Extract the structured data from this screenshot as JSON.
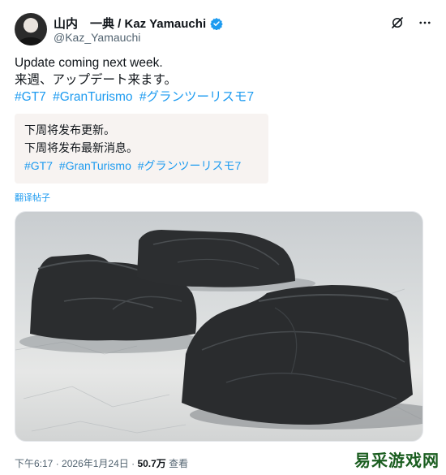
{
  "author": {
    "display_name": "山内　一典 / Kaz Yamauchi",
    "handle": "@Kaz_Yamauchi",
    "verified_icon": "verified-badge-icon",
    "verified_color": "#1d9bf0"
  },
  "header_actions": {
    "grok_icon": "grok-icon",
    "more_icon": "more-dots-icon"
  },
  "tweet": {
    "line1": "Update coming next week.",
    "line2": "来週、アップデート来ます。",
    "hashtags": [
      "#GT7",
      "#GranTurismo",
      "#グランツーリスモ7"
    ]
  },
  "translation": {
    "line1": "下周将发布更新。",
    "line2": "下周将发布最新消息。",
    "hashtags": [
      "#GT7",
      "#GranTurismo",
      "#グランツーリスモ7"
    ],
    "link_label": "翻译帖子"
  },
  "meta": {
    "time": "下午6:17",
    "separator": "·",
    "date": "2026年1月24日",
    "views": "50.7万",
    "views_label": "查看"
  },
  "watermark": "易采游戏网",
  "colors": {
    "link": "#1d9bf0",
    "text": "#0f1419",
    "secondary": "#536471",
    "translation_bg": "#f7f3f1"
  }
}
